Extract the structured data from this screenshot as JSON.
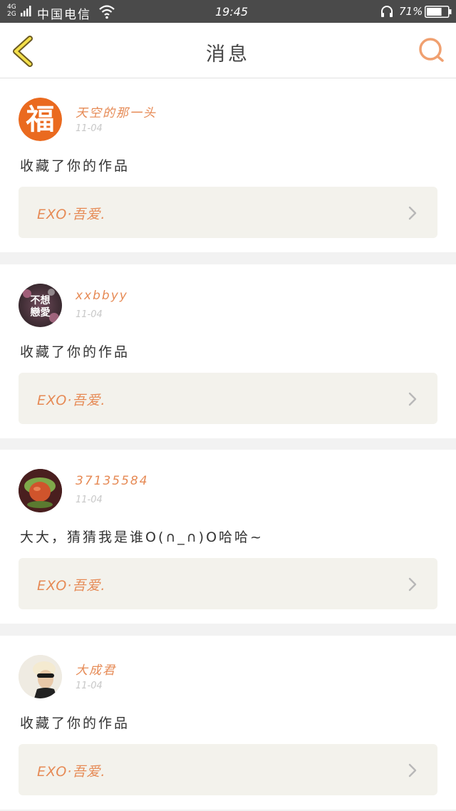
{
  "status_bar": {
    "network": "4G\n2G",
    "carrier": "中国电信",
    "time": "19:45",
    "battery_percent": "71%",
    "battery_level": 0.71,
    "icons": [
      "signal-bars-icon",
      "wifi-icon",
      "headset-icon",
      "battery-icon"
    ]
  },
  "header": {
    "title": "消息",
    "back_icon": "chevron-left-icon",
    "search_icon": "search-icon",
    "accent_color": "#f0a070"
  },
  "messages": [
    {
      "username": "天空的那一头",
      "date": "11-04",
      "text": "收藏了你的作品",
      "work_title": "EXO·吾爱.",
      "avatar_glyph": "福"
    },
    {
      "username": "xxbbyy",
      "date": "11-04",
      "text": "收藏了你的作品",
      "work_title": "EXO·吾爱.",
      "avatar_text": "不想\n戀愛"
    },
    {
      "username": "37135584",
      "date": "11-04",
      "text": "大大，猜猜我是谁O(∩_∩)O哈哈~",
      "work_title": "EXO·吾爱."
    },
    {
      "username": "大成君",
      "date": "11-04",
      "text": "收藏了你的作品",
      "work_title": "EXO·吾爱."
    }
  ],
  "colors": {
    "username": "#e68a55",
    "card_bg": "#f3f2ec",
    "status_bar_bg": "#4a4a4a"
  }
}
